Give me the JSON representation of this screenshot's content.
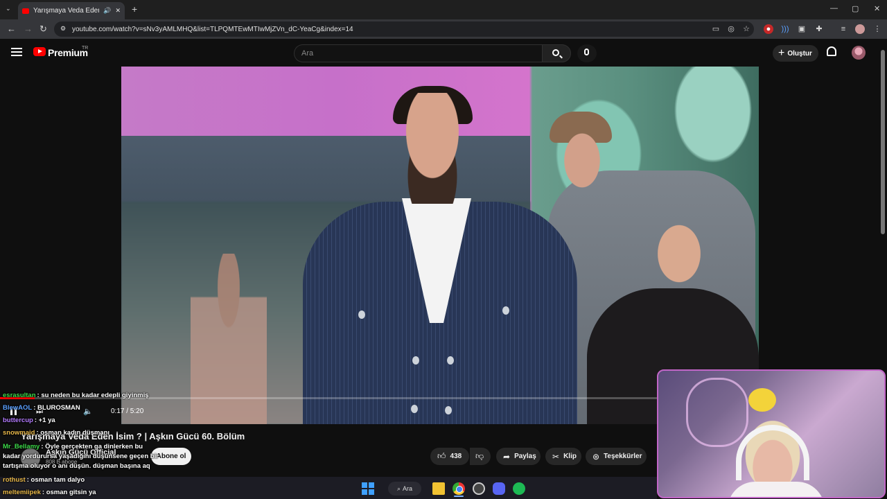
{
  "browser": {
    "tab_title": "Yarışmaya Veda Eden İsim ?",
    "url": "youtube.com/watch?v=sNv3yAMLMHQ&list=TLPQMTEwMTIwMjZVn_dC-YeaCg&index=14",
    "window_controls": {
      "minimize": "—",
      "maximize": "▢",
      "close": "✕"
    },
    "new_tab": "+"
  },
  "youtube": {
    "brand": "Premium",
    "region": "TR",
    "search_placeholder": "Ara",
    "create_label": "Oluştur"
  },
  "player": {
    "time": "0:17 / 5:20",
    "progress_fraction": 0.053
  },
  "video": {
    "title": "Yarışmaya Veda Eden İsim ? | Aşkın Gücü 60. Bölüm",
    "channel": "Aşkın Gücü Official",
    "subscribers": "808 B abone",
    "subscribe_label": "Abone ol",
    "likes": "438",
    "share_label": "Paylaş",
    "clip_label": "Klip",
    "thanks_label": "Teşekkürler"
  },
  "chat": [
    {
      "user": "esrasultan",
      "color": "#3ddc4a",
      "text": ": su neden bu kadar edepli giyinmiş"
    },
    {
      "user": "BlewAOL",
      "color": "#5aa0ff",
      "text": ": BLUROSMAN"
    },
    {
      "user": "buttercup",
      "color": "#b47cff",
      "text": ": +1 ya"
    },
    {
      "user": "snowmaid",
      "color": "#e8b84a",
      "text": ": osman kadın düşmanı"
    },
    {
      "user": "Mr_Bellamy",
      "color": "#3ddc4a",
      "text": ": Öyle gerçekten ga dinlerken bu"
    },
    {
      "user": "",
      "color": "#ffffff",
      "text": "kadar yordurursa yaşadığını düşünsene geçen bir"
    },
    {
      "user": "",
      "color": "#ffffff",
      "text": "tartışma oluyor o anı düşün. düşman başına aq"
    },
    {
      "user": "rothust",
      "color": "#e8b84a",
      "text": ": osman tam dalyo"
    },
    {
      "user": "meltemiipek",
      "color": "#e8b84a",
      "text": ": osman gitsin ya"
    }
  ],
  "taskbar": {
    "search_label": "Ara"
  },
  "colors": {
    "yt_red": "#ff0000",
    "background": "#0f0f0f",
    "cam_border": "#c266c8"
  }
}
